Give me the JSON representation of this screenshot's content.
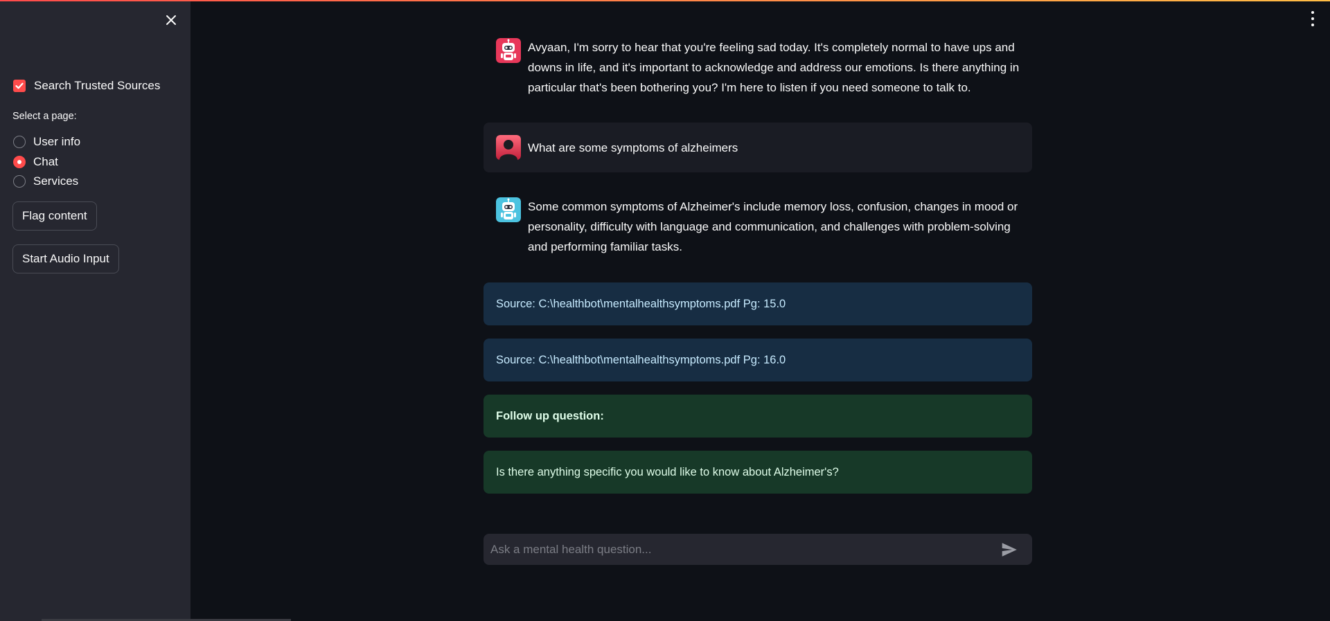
{
  "colors": {
    "accent": "#ff4b4b",
    "sidebar_bg": "#262730",
    "main_bg": "#0e1117",
    "source_box": "#172d43",
    "followup_box": "#173928"
  },
  "sidebar": {
    "close_icon": "close-icon",
    "search_trusted": {
      "label": "Search Trusted Sources",
      "checked": true
    },
    "page_select": {
      "title": "Select a page:",
      "options": [
        {
          "label": "User info",
          "selected": false
        },
        {
          "label": "Chat",
          "selected": true
        },
        {
          "label": "Services",
          "selected": false
        }
      ]
    },
    "flag_button": "Flag content",
    "audio_button": "Start Audio Input"
  },
  "chat": {
    "messages": [
      {
        "role": "assistant",
        "avatar_icon": "robot-icon-red",
        "text": "Avyaan, I'm sorry to hear that you're feeling sad today. It's completely normal to have ups and downs in life, and it's important to acknowledge and address our emotions. Is there anything in particular that's been bothering you? I'm here to listen if you need someone to talk to."
      },
      {
        "role": "user",
        "avatar_icon": "user-silhouette-icon",
        "text": "What are some symptoms of alzheimers"
      },
      {
        "role": "assistant",
        "avatar_icon": "robot-icon-blue",
        "text": "Some common symptoms of Alzheimer's include memory loss, confusion, changes in mood or personality, difficulty with language and communication, and challenges with problem-solving and performing familiar tasks."
      }
    ],
    "sources": [
      "Source: C:\\healthbot\\mentalhealthsymptoms.pdf Pg: 15.0",
      "Source: C:\\healthbot\\mentalhealthsymptoms.pdf Pg: 16.0"
    ],
    "followup_title": "Follow up question:",
    "followup_question": "Is there anything specific you would like to know about Alzheimer's?",
    "input_placeholder": "Ask a mental health question...",
    "send_icon": "send-icon"
  },
  "menu_icon": "kebab-menu-icon"
}
